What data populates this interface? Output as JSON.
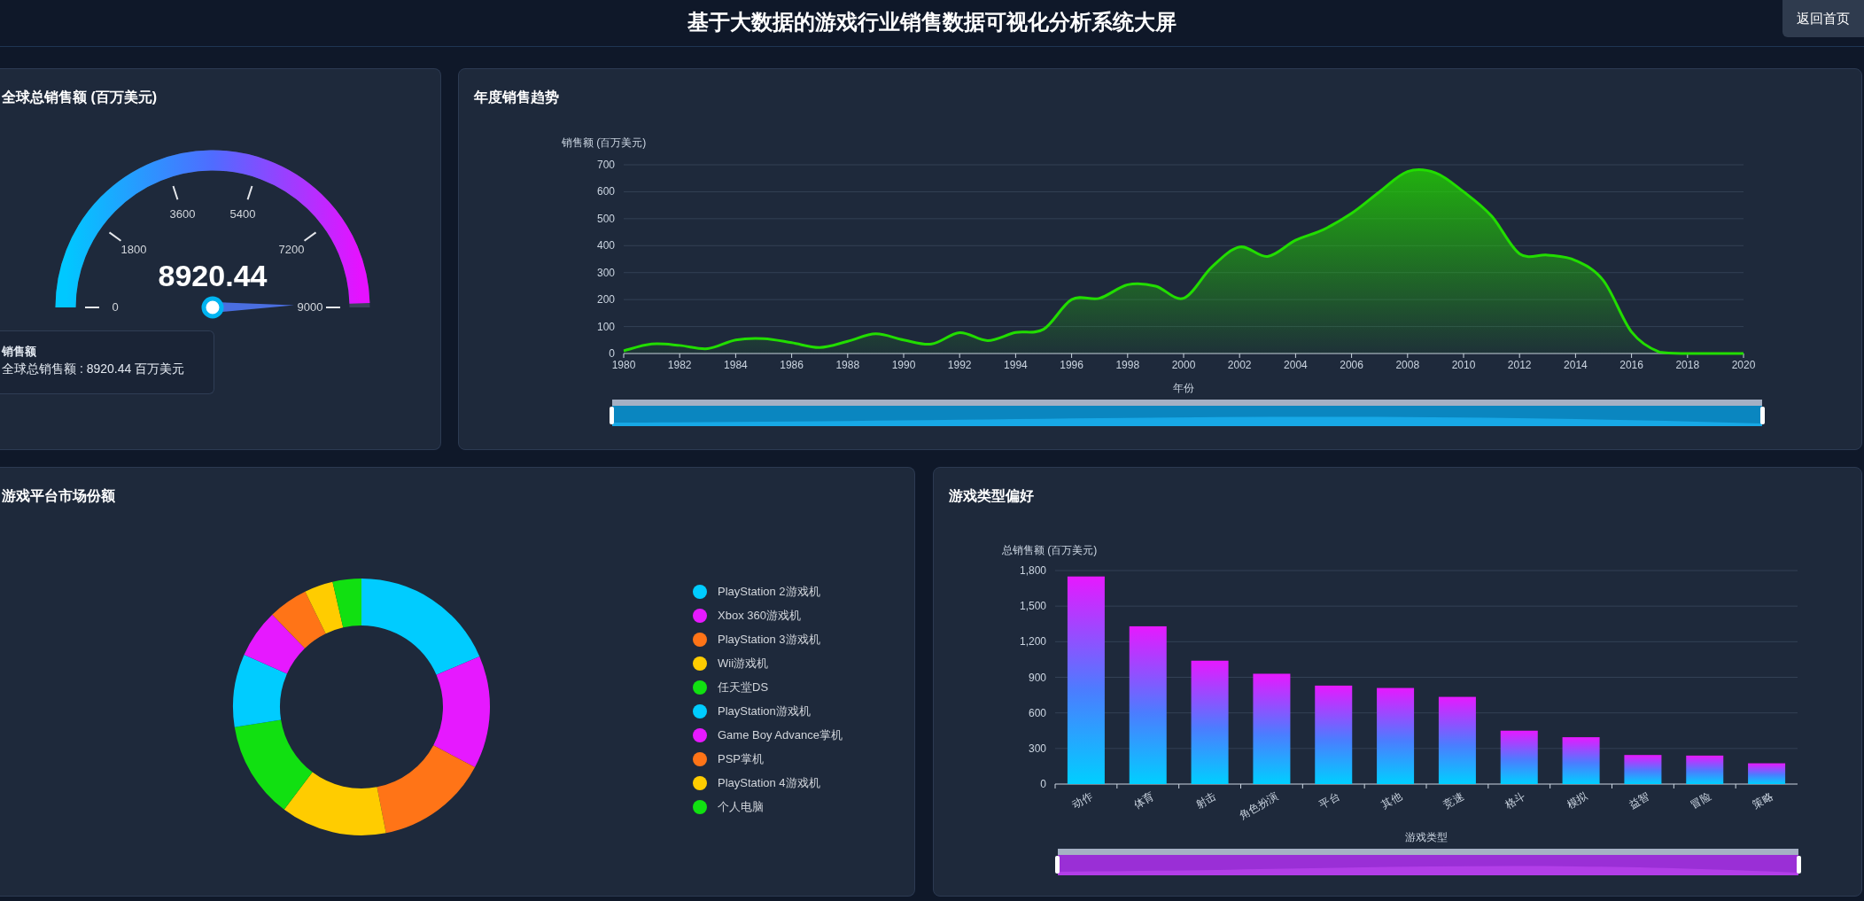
{
  "header": {
    "title": "基于大数据的游戏行业销售数据可视化分析系统大屏",
    "home_button": "返回首页"
  },
  "gauge_panel": {
    "title": "全球总销售额 (百万美元)",
    "value": "8920.44",
    "level": 0.9912,
    "ticks": [
      "0",
      "1800",
      "3600",
      "5400",
      "7200",
      "9000"
    ],
    "tooltip": {
      "title": "销售额",
      "line": "全球总销售额 : 8920.44 百万美元"
    }
  },
  "trend_panel": {
    "title": "年度销售趋势",
    "chart_data": {
      "type": "area",
      "xlabel": "年份",
      "ylabel": "销售额 (百万美元)",
      "x": [
        1980,
        1981,
        1982,
        1983,
        1984,
        1985,
        1986,
        1987,
        1988,
        1989,
        1990,
        1991,
        1992,
        1993,
        1994,
        1995,
        1996,
        1997,
        1998,
        1999,
        2000,
        2001,
        2002,
        2003,
        2004,
        2005,
        2006,
        2007,
        2008,
        2009,
        2010,
        2011,
        2012,
        2013,
        2014,
        2015,
        2016,
        2017,
        2018,
        2019,
        2020
      ],
      "grid": true,
      "series": [
        {
          "color": "#22dd00",
          "values": [
            10,
            35,
            30,
            18,
            50,
            55,
            40,
            22,
            45,
            73,
            50,
            35,
            77,
            48,
            78,
            90,
            200,
            205,
            255,
            250,
            205,
            320,
            395,
            360,
            420,
            460,
            520,
            600,
            675,
            670,
            600,
            510,
            370,
            365,
            345,
            270,
            80,
            5,
            0,
            0,
            0
          ]
        }
      ],
      "xlim": [
        1980,
        2020
      ],
      "ylim": [
        0,
        700
      ],
      "xticks": [
        1980,
        1982,
        1984,
        1986,
        1988,
        1990,
        1992,
        1994,
        1996,
        1998,
        2000,
        2002,
        2004,
        2006,
        2008,
        2010,
        2012,
        2014,
        2016,
        2018,
        2020
      ],
      "yticks": [
        0,
        100,
        200,
        300,
        400,
        500,
        600,
        700
      ]
    }
  },
  "platform_panel": {
    "title": "游戏平台市场份额",
    "legend": [
      {
        "label": "PlayStation 2游戏机",
        "color": "#00ccff"
      },
      {
        "label": "Xbox 360游戏机",
        "color": "#e619ff"
      },
      {
        "label": "PlayStation 3游戏机",
        "color": "#ff7417"
      },
      {
        "label": "Wii游戏机",
        "color": "#ffcc00"
      },
      {
        "label": "任天堂DS",
        "color": "#11e011"
      },
      {
        "label": "PlayStation游戏机",
        "color": "#00ccff"
      },
      {
        "label": "Game Boy Advance掌机",
        "color": "#e619ff"
      },
      {
        "label": "PSP掌机",
        "color": "#ff7417"
      },
      {
        "label": "PlayStation 4游戏机",
        "color": "#ffcc00"
      },
      {
        "label": "个人电脑",
        "color": "#11e011"
      }
    ]
  },
  "genre_panel": {
    "title": "游戏类型偏好",
    "chart_data": {
      "type": "bar",
      "xlabel": "游戏类型",
      "ylabel": "总销售额 (百万美元)",
      "categories": [
        "动作",
        "体育",
        "射击",
        "角色扮演",
        "平台",
        "其他",
        "竞速",
        "格斗",
        "模拟",
        "益智",
        "冒险",
        "策略"
      ],
      "grid": true,
      "series": [
        {
          "color": "#e619ff",
          "values": [
            1750,
            1330,
            1040,
            930,
            830,
            810,
            735,
            450,
            395,
            245,
            240,
            175
          ]
        }
      ],
      "ylim": [
        0,
        1800
      ],
      "yticks": [
        {
          "value": 0,
          "label": "0"
        },
        {
          "value": 300,
          "label": "300"
        },
        {
          "value": 600,
          "label": "600"
        },
        {
          "value": 900,
          "label": "900"
        },
        {
          "value": 1200,
          "label": "1,200"
        },
        {
          "value": 1500,
          "label": "1,500"
        },
        {
          "value": 1800,
          "label": "1,800"
        }
      ]
    }
  }
}
